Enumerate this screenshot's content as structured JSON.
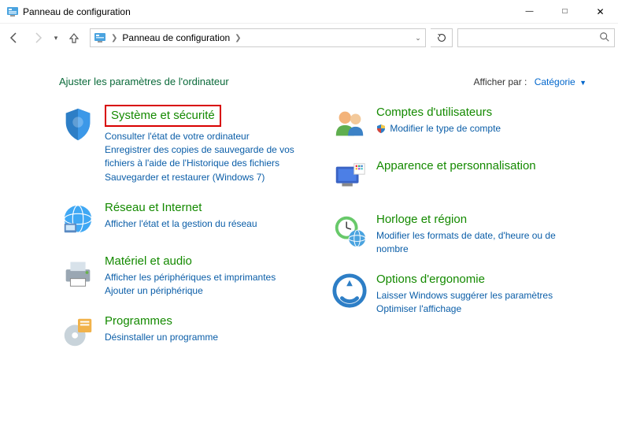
{
  "window": {
    "title": "Panneau de configuration"
  },
  "breadcrumb": {
    "root": "Panneau de configuration"
  },
  "search": {
    "placeholder": ""
  },
  "page": {
    "heading": "Ajuster les paramètres de l'ordinateur",
    "viewby_label": "Afficher par :",
    "viewby_value": "Catégorie"
  },
  "categories": {
    "system_security": {
      "title": "Système et sécurité",
      "sub1": "Consulter l'état de votre ordinateur",
      "sub2": "Enregistrer des copies de sauvegarde de vos fichiers à l'aide de l'Historique des fichiers",
      "sub3": "Sauvegarder et restaurer (Windows 7)"
    },
    "network": {
      "title": "Réseau et Internet",
      "sub1": "Afficher l'état et la gestion du réseau"
    },
    "hardware": {
      "title": "Matériel et audio",
      "sub1": "Afficher les périphériques et imprimantes",
      "sub2": "Ajouter un périphérique"
    },
    "programs": {
      "title": "Programmes",
      "sub1": "Désinstaller un programme"
    },
    "accounts": {
      "title": "Comptes d'utilisateurs",
      "sub1": "Modifier le type de compte"
    },
    "appearance": {
      "title": "Apparence et personnalisation"
    },
    "clock": {
      "title": "Horloge et région",
      "sub1": "Modifier les formats de date, d'heure ou de nombre"
    },
    "ease": {
      "title": "Options d'ergonomie",
      "sub1": "Laisser Windows suggérer les paramètres",
      "sub2": "Optimiser l'affichage"
    }
  }
}
